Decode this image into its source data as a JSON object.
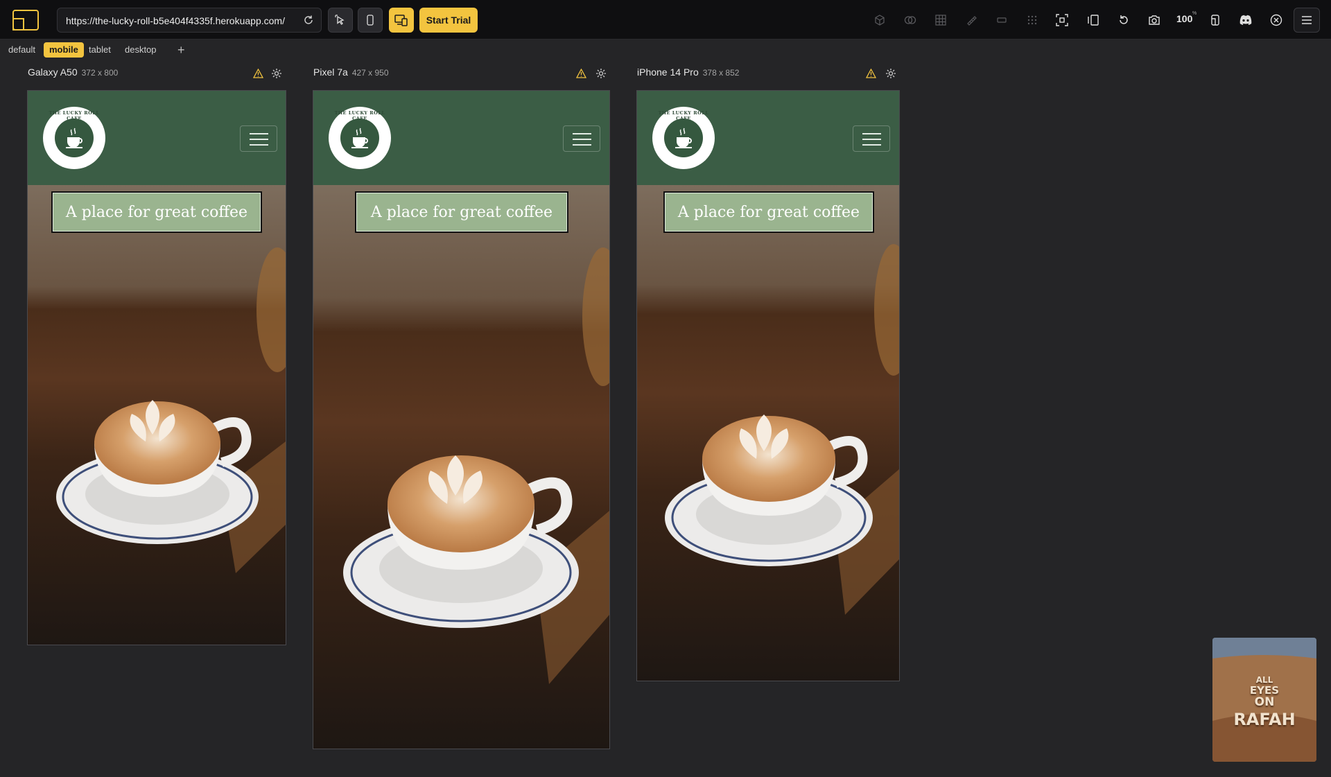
{
  "toolbar": {
    "url": "https://the-lucky-roll-b5e404f4335f.herokuapp.com/",
    "trial_label": "Start Trial",
    "zoom": "100",
    "zoom_unit": "%"
  },
  "tabs": [
    "default",
    "mobile",
    "tablet",
    "desktop"
  ],
  "active_tab": "mobile",
  "devices": [
    {
      "name": "Galaxy A50",
      "size": "372 x 800"
    },
    {
      "name": "Pixel 7a",
      "size": "427 x 950"
    },
    {
      "name": "iPhone 14 Pro",
      "size": "378 x 852"
    }
  ],
  "site": {
    "logo_text": "THE LUCKY ROLL CAFE",
    "hero_title": "A place for great coffee"
  },
  "thumbnail": {
    "line1": "ALL",
    "line2": "EYES",
    "line3": "ON",
    "line4": "RAFAH"
  },
  "colors": {
    "accent": "#f3c43f",
    "site_header": "#3b5d45",
    "hero_box": "#9ab48f"
  }
}
